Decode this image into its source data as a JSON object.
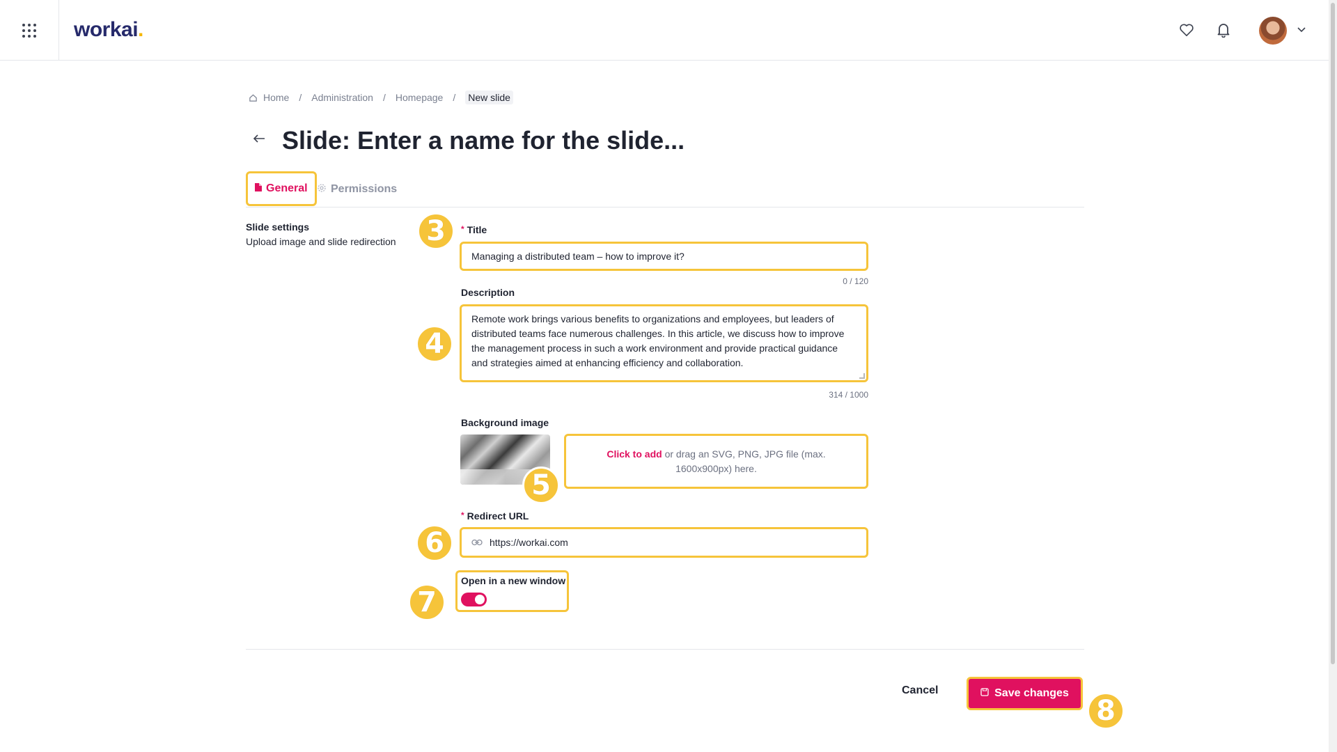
{
  "brand": {
    "name": "workai",
    "dot": ".",
    "accent": "#e0115f",
    "logo_color": "#262a6b",
    "dot_color": "#f5b700"
  },
  "header": {
    "icons": [
      "apps-grid-icon",
      "heart-icon",
      "bell-icon",
      "avatar",
      "chevron-down-icon"
    ]
  },
  "breadcrumb": {
    "items": [
      "Home",
      "Administration",
      "Homepage",
      "New slide"
    ],
    "separator": "/"
  },
  "page": {
    "title_prefix": "Slide:",
    "title_name": "Enter a name for the slide..."
  },
  "tabs": [
    {
      "label": "General",
      "icon": "document-icon",
      "active": true
    },
    {
      "label": "Permissions",
      "icon": "settings-icon",
      "active": false
    }
  ],
  "section": {
    "title": "Slide settings",
    "subtitle": "Upload image and slide redirection"
  },
  "form": {
    "title": {
      "label": "Title",
      "required": "*",
      "value": "Managing a distributed team – how to improve it?",
      "counter": "0 / 120"
    },
    "description": {
      "label": "Description",
      "value": "Remote work brings various benefits to organizations and employees, but leaders of distributed teams face numerous challenges. In this article, we discuss how to improve the management process in such a work environment and provide practical guidance and strategies aimed at enhancing efficiency and collaboration.",
      "counter": "314 / 1000"
    },
    "background": {
      "label": "Background image",
      "link_text": "Click to add",
      "hint": " or drag an SVG, PNG, JPG file (max. 1600x900px) here."
    },
    "redirect": {
      "label": "Redirect URL",
      "required": "*",
      "value": "https://workai.com",
      "icon": "link-icon"
    },
    "new_window": {
      "label": "Open in a new window",
      "enabled": true
    }
  },
  "actions": {
    "cancel": "Cancel",
    "save": "Save changes",
    "save_icon": "save-icon"
  },
  "badges": [
    "3",
    "4",
    "5",
    "6",
    "7",
    "8"
  ],
  "highlight_color": "#f6c43a"
}
